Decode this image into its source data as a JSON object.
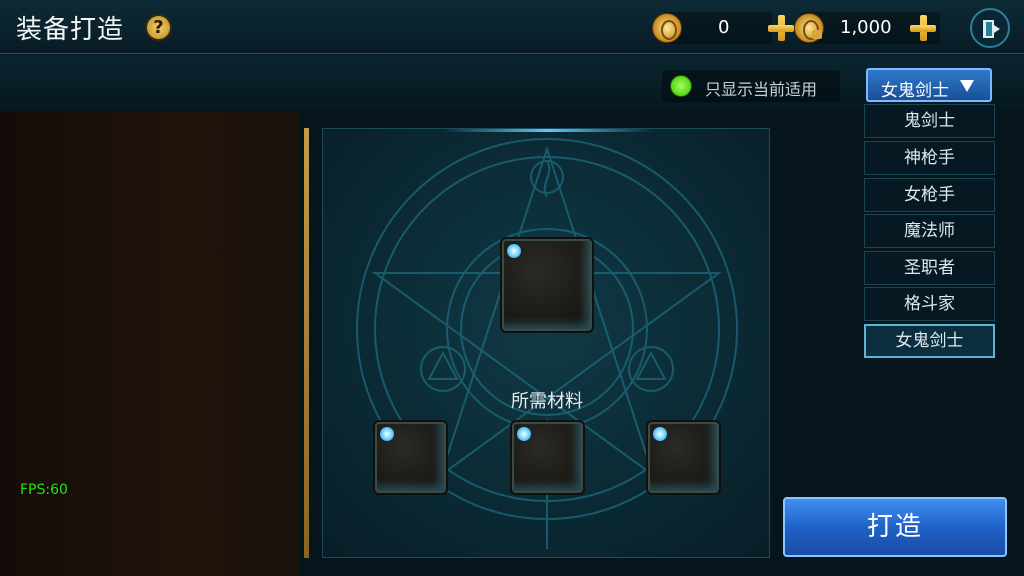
{
  "header": {
    "title": "装备打造",
    "help_icon": "?",
    "currency_gold": "0",
    "currency_bound_gold": "1,000"
  },
  "filter": {
    "show_current_only_label": "只显示当前适用",
    "toggle_color": "#5ee00a"
  },
  "class_select": {
    "selected": "女鬼剑士",
    "options": [
      "鬼剑士",
      "神枪手",
      "女枪手",
      "魔法师",
      "圣职者",
      "格斗家",
      "女鬼剑士"
    ]
  },
  "forge": {
    "materials_label": "所需材料"
  },
  "craft_button_label": "打造",
  "fps_text": "FPS:60"
}
